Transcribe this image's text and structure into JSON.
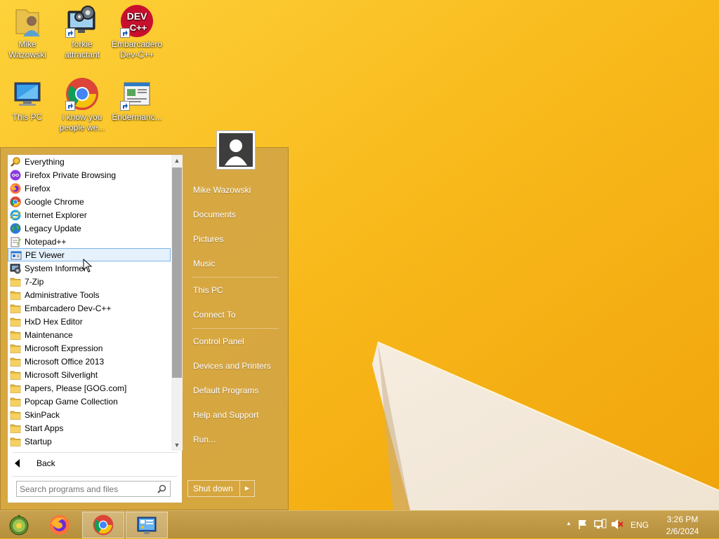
{
  "desktop": {
    "icons": [
      {
        "label": "Mike Wazowski"
      },
      {
        "label": "forkie attractant"
      },
      {
        "label": "Embarcadero Dev-C++"
      },
      {
        "label": "This PC"
      },
      {
        "label": "i know you people we..."
      },
      {
        "label": "Endermanc..."
      }
    ],
    "devcpp_badge_top": "DEV",
    "devcpp_badge_bottom": "C++"
  },
  "start_menu": {
    "programs": [
      {
        "label": "Everything",
        "icon": "magnifier-icon"
      },
      {
        "label": "Firefox Private Browsing",
        "icon": "firefox-private-icon"
      },
      {
        "label": "Firefox",
        "icon": "firefox-icon"
      },
      {
        "label": "Google Chrome",
        "icon": "chrome-icon"
      },
      {
        "label": "Internet Explorer",
        "icon": "ie-icon"
      },
      {
        "label": "Legacy Update",
        "icon": "globe-icon"
      },
      {
        "label": "Notepad++",
        "icon": "notepad-icon"
      },
      {
        "label": "PE Viewer",
        "icon": "pe-viewer-icon",
        "highlighted": true
      },
      {
        "label": "System Informer",
        "icon": "system-informer-icon"
      },
      {
        "label": "7-Zip",
        "icon": "folder-icon"
      },
      {
        "label": "Administrative Tools",
        "icon": "folder-icon"
      },
      {
        "label": "Embarcadero Dev-C++",
        "icon": "folder-icon"
      },
      {
        "label": "HxD Hex Editor",
        "icon": "folder-icon"
      },
      {
        "label": "Maintenance",
        "icon": "folder-icon"
      },
      {
        "label": "Microsoft Expression",
        "icon": "folder-icon"
      },
      {
        "label": "Microsoft Office 2013",
        "icon": "folder-icon"
      },
      {
        "label": "Microsoft Silverlight",
        "icon": "folder-icon"
      },
      {
        "label": "Papers, Please [GOG.com]",
        "icon": "folder-icon"
      },
      {
        "label": "Popcap Game Collection",
        "icon": "folder-icon"
      },
      {
        "label": "SkinPack",
        "icon": "folder-icon"
      },
      {
        "label": "Start Apps",
        "icon": "folder-icon"
      },
      {
        "label": "Startup",
        "icon": "folder-icon"
      }
    ],
    "back_label": "Back",
    "search_placeholder": "Search programs and files",
    "right_items": [
      {
        "label": "Mike Wazowski"
      },
      {
        "label": "Documents"
      },
      {
        "label": "Pictures"
      },
      {
        "label": "Music"
      },
      {
        "label": "This PC"
      },
      {
        "label": "Connect To"
      },
      {
        "label": "Control Panel"
      },
      {
        "label": "Devices and Printers"
      },
      {
        "label": "Default Programs"
      },
      {
        "label": "Help and Support"
      },
      {
        "label": "Run..."
      }
    ],
    "shutdown_label": "Shut down",
    "shutdown_arrow": "▶"
  },
  "taskbar": {
    "apps": [
      {
        "name": "start-orb"
      },
      {
        "name": "firefox"
      },
      {
        "name": "chrome"
      },
      {
        "name": "control-panel"
      }
    ],
    "tray": {
      "chevron": "▲",
      "language": "ENG",
      "time": "3:26 PM",
      "date": "2/6/2024"
    }
  },
  "colors": {
    "wallpaper": "#f8b81a",
    "start_menu_bg": "#d2a446",
    "highlight": "#e5f1fb"
  }
}
